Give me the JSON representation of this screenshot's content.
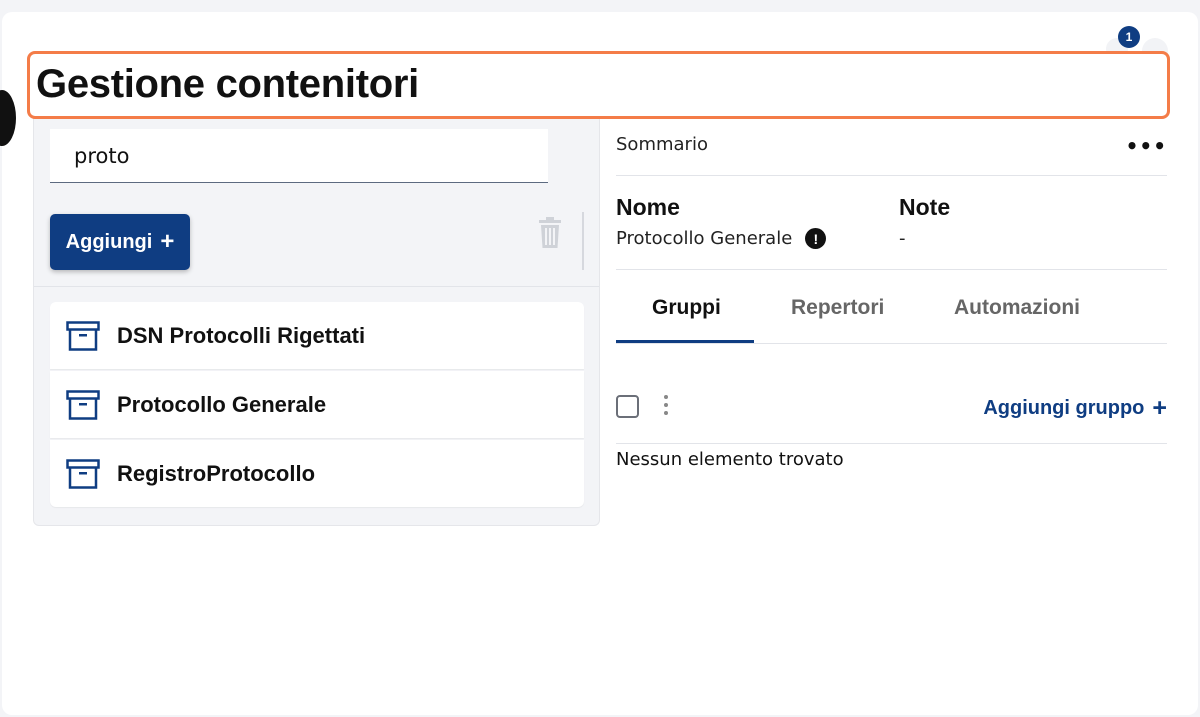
{
  "notifications": {
    "count": "1"
  },
  "header": {
    "title": "Gestione contenitori"
  },
  "search": {
    "value": "proto",
    "placeholder": ""
  },
  "toolbar": {
    "add_label": "Aggiungi",
    "add_icon": "plus-icon",
    "delete_icon": "trash-icon"
  },
  "containers": [
    {
      "label": "DSN Protocolli Rigettati",
      "icon": "archive-box-icon"
    },
    {
      "label": "Protocollo Generale",
      "icon": "archive-box-icon"
    },
    {
      "label": "RegistroProtocollo",
      "icon": "archive-box-icon"
    }
  ],
  "detail": {
    "summary_label": "Sommario",
    "more_label": "•••",
    "name_label": "Nome",
    "name_value": "Protocollo Generale",
    "warning_icon": "exclamation-icon",
    "note_label": "Note",
    "note_value": "-",
    "tabs": [
      {
        "label": "Gruppi",
        "active": true
      },
      {
        "label": "Repertori",
        "active": false
      },
      {
        "label": "Automazioni",
        "active": false
      }
    ],
    "add_group_label": "Aggiungi gruppo",
    "empty_message": "Nessun elemento trovato"
  },
  "colors": {
    "primary": "#0f3d82",
    "highlight": "#f47c48",
    "panel_bg": "#f3f4f7"
  }
}
